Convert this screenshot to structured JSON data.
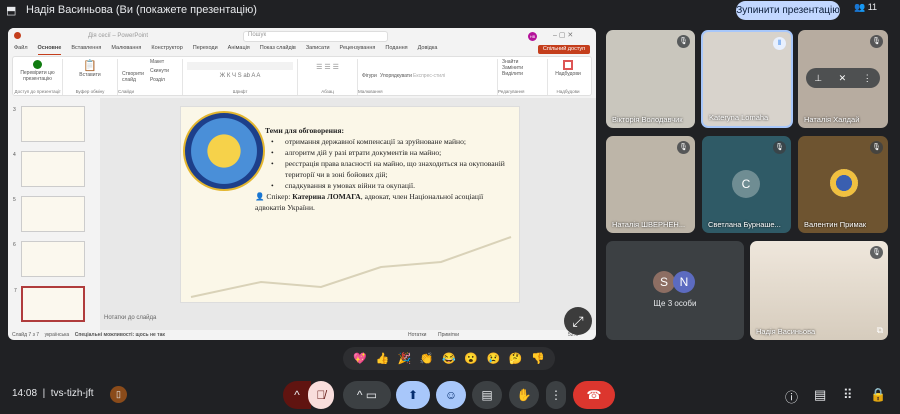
{
  "topbar": {
    "presenter_title": "Надія Васиньова (Ви (покажете презентацію)",
    "stop_button": "Зупинити презентацію",
    "people_count": "11"
  },
  "ppt": {
    "title": "Дія сесії – PowerPoint",
    "search": "Пошук",
    "avatar": "НВ",
    "tabs": [
      "Файл",
      "Основне",
      "Вставлення",
      "Малювання",
      "Конструктор",
      "Переходи",
      "Анімація",
      "Показ слайдів",
      "Записати",
      "Рецензування",
      "Подання",
      "Довідка"
    ],
    "share": "Спільний доступ",
    "groups": [
      "Доступ до презентації",
      "Буфер обміну",
      "Слайди",
      "Шрифт",
      "Абзац",
      "Малювання",
      "Редагування",
      "Надбудови"
    ],
    "ribbon_items": {
      "check": "Перевірити цю презентацію",
      "paste": "Вставити",
      "new_slide": "Створити слайд",
      "layout": "Макет",
      "reset": "Скинути",
      "section": "Розділ",
      "shapes": "Фігури",
      "arrange": "Упорядкувати",
      "quick_styles": "Експрес-стилі",
      "find": "Знайти",
      "replace": "Замінити",
      "select": "Виділити",
      "addins": "Надбудови"
    },
    "thumb_numbers": [
      "3",
      "4",
      "5",
      "6",
      "7"
    ],
    "slide": {
      "heading": "Теми для обговорення:",
      "bullets": [
        "отримання державної компенсації за зруйноване майно;",
        "алгоритм дій у разі втрати документів на майно;",
        "реєстрація права власності на майно, що знаходиться на окупованій території чи в зоні бойових дій;",
        "спадкування в умовах війни та окупації."
      ],
      "speaker_label": "Спікер:",
      "speaker_name": "Катерина ЛОМАГА",
      "speaker_rest": ", адвокат, член Національної асоціації адвокатів України."
    },
    "notes": "Нотатки до слайда",
    "status": {
      "slide": "Слайд 7 з 7",
      "lang": "українська",
      "accessibility": "Спеціальні можливості: щось не так",
      "notes": "Нотатки",
      "comments": "Примітки",
      "zoom": "52%"
    }
  },
  "participants": [
    {
      "name": "Вікторія Володавчик",
      "bg": "#c9c6bd"
    },
    {
      "name": "Kateryna Lomaha",
      "bg": "#d8d3cc",
      "speaking": true
    },
    {
      "name": "Наталія Халдай",
      "bg": "#b7aca0"
    },
    {
      "name": "Наталія ШВЕРНЕН...",
      "bg": "#bdb5a8"
    },
    {
      "name": "Светлана Бурнаше...",
      "bg": "#2f5a66",
      "initial": "С"
    },
    {
      "name": "Валентин Примак",
      "bg": "#6e5430"
    }
  ],
  "others": {
    "label": "Ще 3 особи",
    "avatars": [
      "S",
      "N"
    ]
  },
  "self": {
    "name": "Надія Васиньова"
  },
  "reactions": [
    "💖",
    "👍",
    "🎉",
    "👏",
    "😂",
    "😮",
    "😢",
    "🤔",
    "👎"
  ],
  "bottom": {
    "time": "14:08",
    "code": "tvs-tizh-jft"
  }
}
